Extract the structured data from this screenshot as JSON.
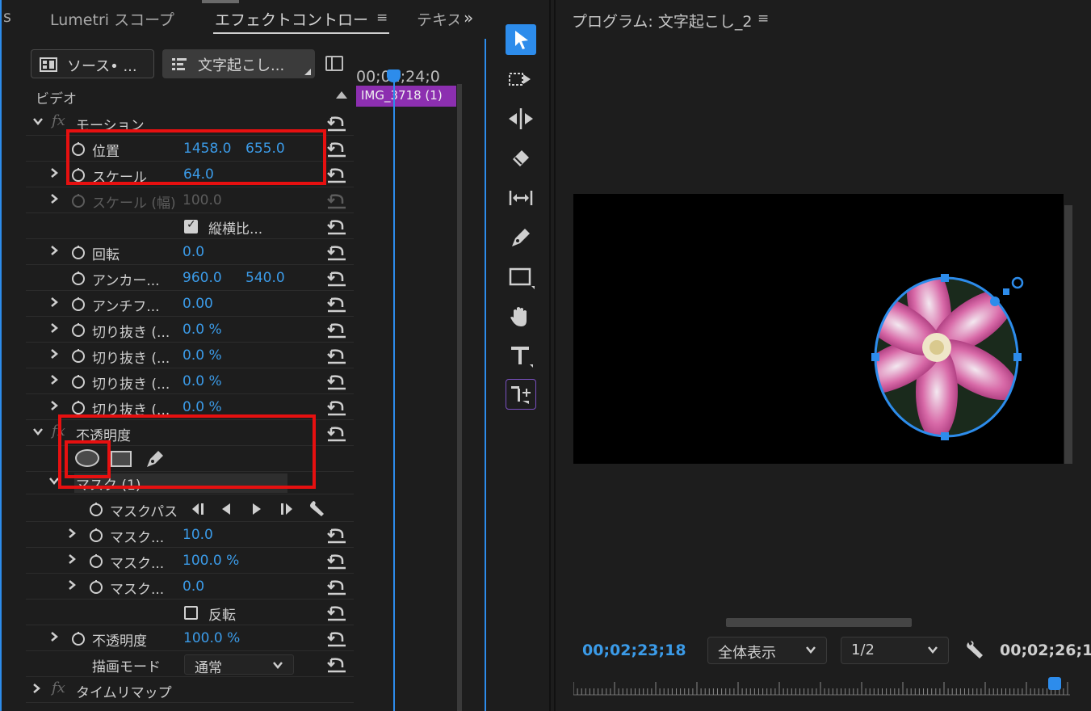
{
  "tabs": {
    "partial_left": "s",
    "lumetri": "Lumetri スコープ",
    "effect_controls": "エフェクトコントロー",
    "text_partial": "テキス",
    "overflow": "»",
    "menu": "≡"
  },
  "source_button": {
    "label": "ソース• ..."
  },
  "sequence_button": {
    "label": "文字起こし..."
  },
  "section": {
    "video": "ビデオ"
  },
  "timeline": {
    "time": "00;02;24;0",
    "clip": "IMG_3718 (1)"
  },
  "rows": {
    "motion": "モーション",
    "position": {
      "label": "位置",
      "x": "1458.0",
      "y": "655.0"
    },
    "scale": {
      "label": "スケール",
      "value": "64.0"
    },
    "scale_width": {
      "label": "スケール (幅)",
      "value": "100.0"
    },
    "aspect": {
      "label": "縦横比...",
      "checked": true
    },
    "rotation": {
      "label": "回転",
      "value": "0.0"
    },
    "anchor": {
      "label": "アンカー...",
      "x": "960.0",
      "y": "540.0"
    },
    "antiflicker": {
      "label": "アンチフ...",
      "value": "0.00"
    },
    "crop1": {
      "label": "切り抜き (...",
      "value": "0.0 %"
    },
    "crop2": {
      "label": "切り抜き (...",
      "value": "0.0 %"
    },
    "crop3": {
      "label": "切り抜き (...",
      "value": "0.0 %"
    },
    "crop4": {
      "label": "切り抜き (...",
      "value": "0.0 %"
    },
    "opacity_section": "不透明度",
    "mask": "マスク (1)",
    "mask_path": "マスクパス",
    "mask_feather": {
      "label": "マスク...",
      "value": "10.0"
    },
    "mask_opacity": {
      "label": "マスク...",
      "value": "100.0 %"
    },
    "mask_expansion": {
      "label": "マスク...",
      "value": "0.0"
    },
    "invert": {
      "label": "反転",
      "checked": false
    },
    "opacity": {
      "label": "不透明度",
      "value": "100.0 %"
    },
    "blend_mode": {
      "label": "描画モード",
      "value": "通常"
    },
    "time_remap": "タイムリマップ",
    "fx": "fx"
  },
  "program": {
    "title": "プログラム: 文字起こし_2",
    "menu": "≡",
    "current_time": "00;02;23;18",
    "zoom": "全体表示",
    "resolution": "1/2",
    "duration": "00;02;26;1"
  },
  "colors": {
    "accent": "#2d8ceb",
    "value_blue": "#3b9be8",
    "highlight_red": "#e61010",
    "clip_purple": "#8c2fb0"
  }
}
